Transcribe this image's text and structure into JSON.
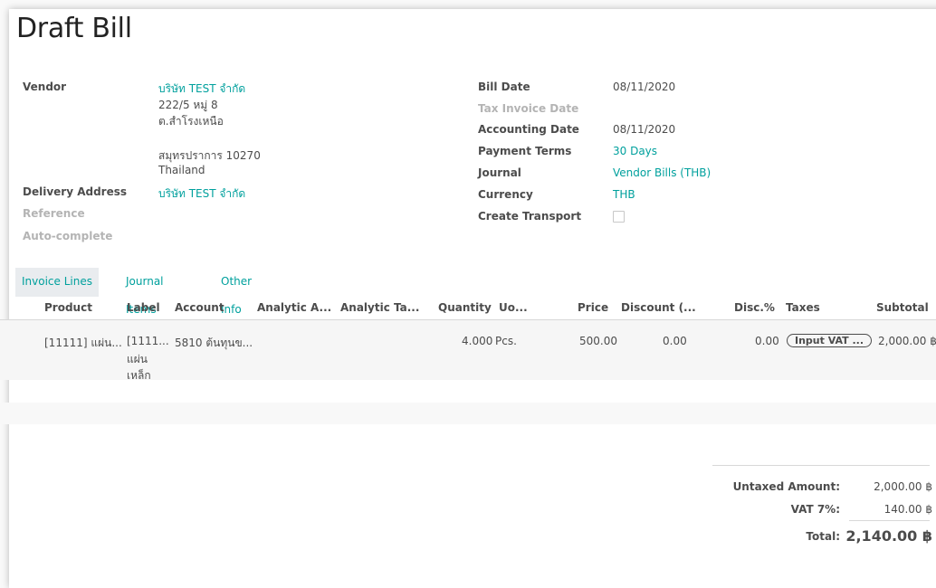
{
  "page": {
    "title": "Draft Bill"
  },
  "left_fields": {
    "vendor_label": "Vendor",
    "vendor_name": "บริษัท TEST จำกัด",
    "vendor_address_line1": "222/5 หมู่ 8",
    "vendor_address_line2": "ต.สำโรงเหนือ",
    "vendor_address_line3": "สมุทรปราการ 10270",
    "vendor_address_line4": "Thailand",
    "delivery_label": "Delivery Address",
    "delivery_value": "บริษัท TEST จำกัด",
    "reference_label": "Reference",
    "autocomplete_label": "Auto-complete"
  },
  "right_fields": {
    "bill_date_label": "Bill Date",
    "bill_date_value": "08/11/2020",
    "tax_invoice_date_label": "Tax Invoice Date",
    "accounting_date_label": "Accounting Date",
    "accounting_date_value": "08/11/2020",
    "payment_terms_label": "Payment Terms",
    "payment_terms_value": "30 Days",
    "journal_label": "Journal",
    "journal_value": "Vendor Bills (THB)",
    "currency_label": "Currency",
    "currency_value": "THB",
    "create_transport_label": "Create Transport",
    "create_transport_checked": false
  },
  "tabs": [
    {
      "label": "Invoice Lines",
      "active": true
    },
    {
      "label": "Journal Items",
      "active": false
    },
    {
      "label": "Other Info",
      "active": false
    }
  ],
  "table": {
    "headers": {
      "product": "Product",
      "label": "Label",
      "account": "Account",
      "analytic_account": "Analytic A...",
      "analytic_tags": "Analytic Ta...",
      "quantity": "Quantity",
      "uom": "Uo...",
      "price": "Price",
      "discount": "Discount (...",
      "disc_pct": "Disc.%",
      "taxes": "Taxes",
      "subtotal": "Subtotal"
    },
    "rows": [
      {
        "product": "[11111] แผ่น...",
        "label_line1": "[1111...",
        "label_line2": "แผ่น",
        "label_line3": "เหล็ก",
        "account": "5810 ต้นทุนข...",
        "quantity": "4.000",
        "uom": "Pcs.",
        "price": "500.00",
        "discount": "0.00",
        "disc_pct": "0.00",
        "tax": "Input VAT ...",
        "subtotal": "2,000.00 ฿"
      }
    ]
  },
  "totals": {
    "untaxed_label": "Untaxed Amount:",
    "untaxed_value": "2,000.00 ฿",
    "vat_label": "VAT 7%:",
    "vat_value": "140.00 ฿",
    "total_label": "Total:",
    "total_value": "2,140.00 ฿"
  }
}
